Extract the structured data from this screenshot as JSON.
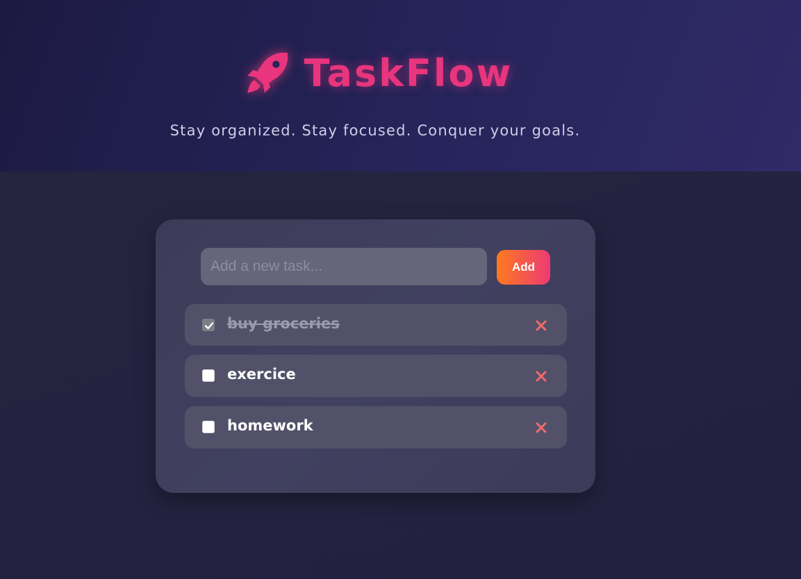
{
  "header": {
    "brand_name": "TaskFlow",
    "brand_icon": "rocket-icon",
    "tagline": "Stay organized. Stay focused. Conquer your goals."
  },
  "input": {
    "placeholder": "Add a new task...",
    "value": ""
  },
  "add_button": {
    "label": "Add"
  },
  "tasks": [
    {
      "label": "buy groceries",
      "done": true
    },
    {
      "label": "exercice",
      "done": false
    },
    {
      "label": "homework",
      "done": false
    }
  ],
  "colors": {
    "brand": "#e8357d",
    "add_gradient_start": "#fd7a1f",
    "add_gradient_end": "#ee3a74",
    "delete_icon": "#f26b6b"
  }
}
